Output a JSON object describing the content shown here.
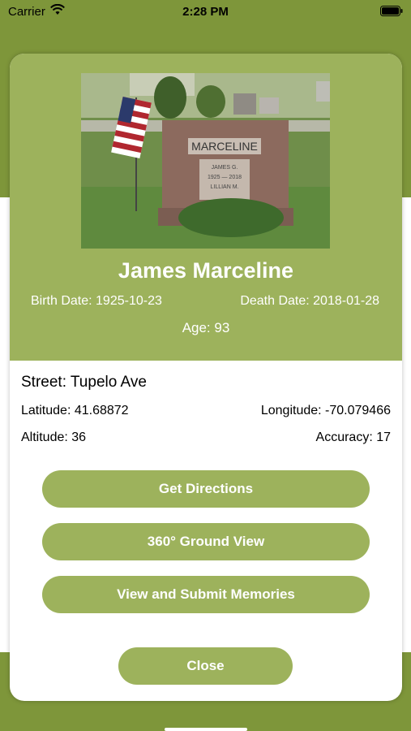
{
  "status_bar": {
    "carrier": "Carrier",
    "time": "2:28 PM",
    "wifi_icon": "wifi-icon",
    "battery_icon": "battery-icon"
  },
  "colors": {
    "header_green": "#9db25c",
    "app_green": "#7e963a",
    "button_green": "#9db25c"
  },
  "person": {
    "photo_alt": "gravestone-photo",
    "name": "James Marceline",
    "birth": "Birth Date: 1925-10-23",
    "death": "Death Date: 2018-01-28",
    "age": "Age: 93"
  },
  "location": {
    "street": "Street: Tupelo Ave",
    "latitude": "Latitude: 41.68872",
    "longitude": "Longitude: -70.079466",
    "altitude": "Altitude: 36",
    "accuracy": "Accuracy: 17"
  },
  "actions": {
    "directions": "Get Directions",
    "ground_view": "360° Ground View",
    "memories": "View and Submit Memories",
    "close": "Close"
  },
  "photo_text": {
    "surname": "MARCELINE",
    "line1": "JAMES G.",
    "line2": "1925 — 2018",
    "line3": "LILLIAN M."
  }
}
